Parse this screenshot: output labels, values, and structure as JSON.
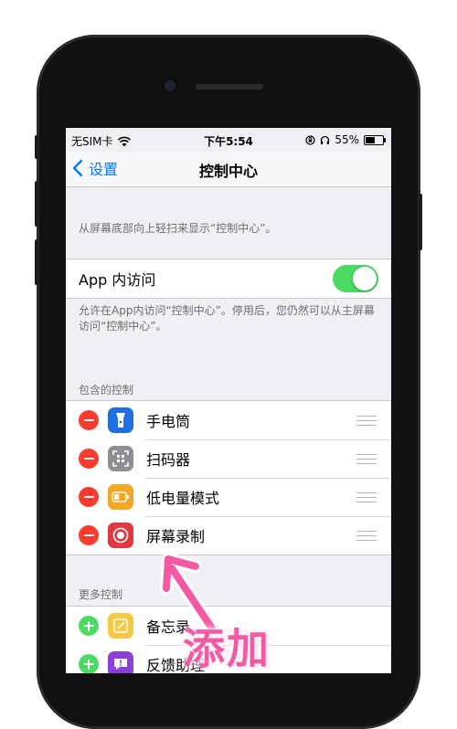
{
  "statusbar": {
    "carrier": "无SIM卡",
    "time": "下午5:54",
    "battery_percent": "55%",
    "battery_level": 0.55
  },
  "navbar": {
    "back_label": "设置",
    "title": "控制中心"
  },
  "intro_text": "从屏幕底部向上轻扫来显示“控制中心”。",
  "app_access": {
    "label": "App 内访问",
    "enabled": true,
    "footer": "允许在App内访问“控制中心”。停用后，您仍然可以从主屏幕访问“控制中心”。"
  },
  "included": {
    "header": "包含的控制",
    "items": [
      {
        "label": "手电筒",
        "icon": "flashlight-icon",
        "color": "#1e6fe0"
      },
      {
        "label": "扫码器",
        "icon": "qr-scanner-icon",
        "color": "#8e8e93"
      },
      {
        "label": "低电量模式",
        "icon": "low-power-icon",
        "color": "#f5a623"
      },
      {
        "label": "屏幕录制",
        "icon": "screen-record-icon",
        "color": "#e0383e"
      }
    ]
  },
  "more": {
    "header": "更多控制",
    "items": [
      {
        "label": "备忘录",
        "icon": "notes-icon",
        "color": "#f7c844"
      },
      {
        "label": "反馈助理",
        "icon": "feedback-icon",
        "color": "#8b3fd9"
      }
    ]
  },
  "annotation": {
    "text": "添加"
  },
  "colors": {
    "accent": "#007aff",
    "toggle_on": "#4cd964",
    "remove": "#ff3b30",
    "annotation": "#f45aa3"
  }
}
